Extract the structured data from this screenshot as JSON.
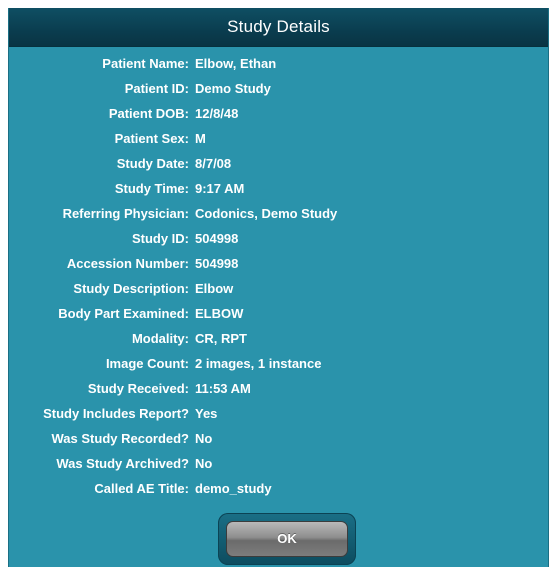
{
  "dialog": {
    "title": "Study Details",
    "ok_label": "OK"
  },
  "fields": [
    {
      "label": "Patient Name:",
      "value": "Elbow, Ethan"
    },
    {
      "label": "Patient ID:",
      "value": "Demo Study"
    },
    {
      "label": "Patient DOB:",
      "value": "12/8/48"
    },
    {
      "label": "Patient Sex:",
      "value": "M"
    },
    {
      "label": "Study Date:",
      "value": "8/7/08"
    },
    {
      "label": "Study Time:",
      "value": "9:17 AM"
    },
    {
      "label": "Referring Physician:",
      "value": "Codonics, Demo Study"
    },
    {
      "label": "Study ID:",
      "value": "504998"
    },
    {
      "label": "Accession Number:",
      "value": "504998"
    },
    {
      "label": "Study Description:",
      "value": "Elbow"
    },
    {
      "label": "Body Part Examined:",
      "value": "ELBOW"
    },
    {
      "label": "Modality:",
      "value": "CR, RPT"
    },
    {
      "label": "Image Count:",
      "value": "2 images, 1 instance"
    },
    {
      "label": "Study Received:",
      "value": "11:53 AM"
    },
    {
      "label": "Study Includes Report?",
      "value": "Yes"
    },
    {
      "label": "Was Study Recorded?",
      "value": "No"
    },
    {
      "label": "Was Study Archived?",
      "value": "No"
    },
    {
      "label": "Called AE Title:",
      "value": "demo_study"
    }
  ],
  "colors": {
    "dialog_background": "#2a93ab",
    "title_bar": "#0a3d4f",
    "text": "#ffffff",
    "button_face": "#8e8e8e"
  }
}
